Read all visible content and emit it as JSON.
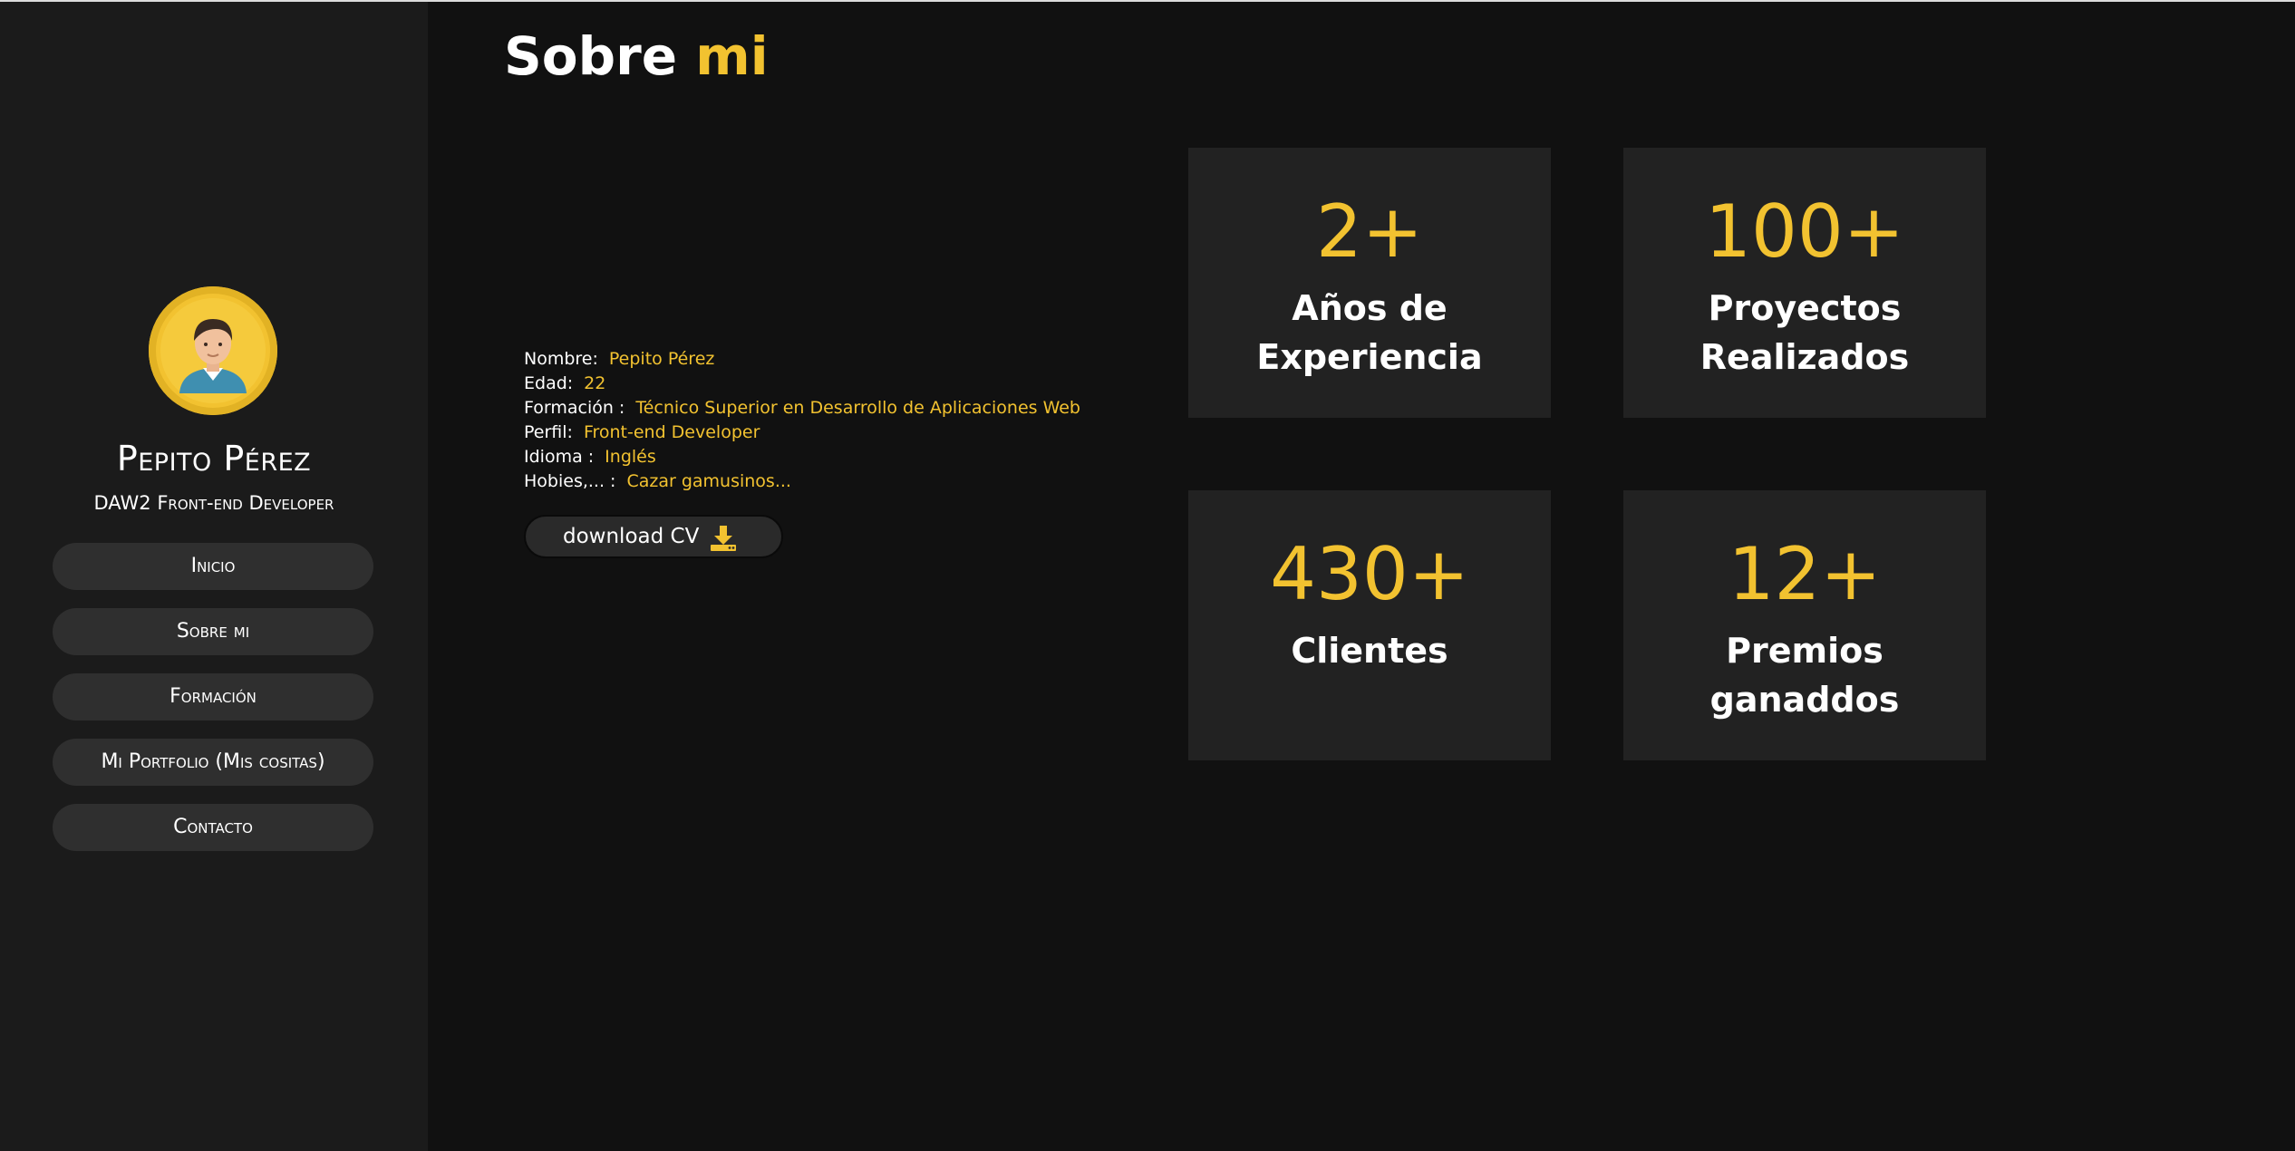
{
  "title": {
    "main": "Sobre ",
    "accent": "mi"
  },
  "profile": {
    "name": "Pepito Pérez",
    "role": "DAW2 Front-end Developer"
  },
  "nav": {
    "items": [
      {
        "label": "Inicio"
      },
      {
        "label": "Sobre mi"
      },
      {
        "label": "Formación"
      },
      {
        "label": "Mi Portfolio (Mis cositas)"
      },
      {
        "label": "Contacto"
      }
    ]
  },
  "info": [
    {
      "label": "Nombre:",
      "value": "Pepito Pérez"
    },
    {
      "label": "Edad:",
      "value": "22"
    },
    {
      "label": "Formación :",
      "value": "Técnico Superior en Desarrollo de Aplicaciones Web"
    },
    {
      "label": "Perfil:",
      "value": "Front-end Developer"
    },
    {
      "label": "Idioma :",
      "value": "Inglés"
    },
    {
      "label": "Hobies,... :",
      "value": "Cazar gamusinos..."
    }
  ],
  "download": {
    "label": "download CV",
    "icon": "download-icon"
  },
  "stats": [
    {
      "number": "2+",
      "label_line1": "Años de",
      "label_line2": "Experiencia"
    },
    {
      "number": "100+",
      "label_line1": "Proyectos",
      "label_line2": "Realizados"
    },
    {
      "number": "430+",
      "label_line1": "Clientes",
      "label_line2": ""
    },
    {
      "number": "12+",
      "label_line1": "Premios",
      "label_line2": "ganaddos"
    }
  ],
  "colors": {
    "accent": "#f2c230",
    "background": "#111111",
    "sidebar": "#1b1b1b",
    "card": "#222222",
    "nav_button": "#2f2f2f"
  }
}
